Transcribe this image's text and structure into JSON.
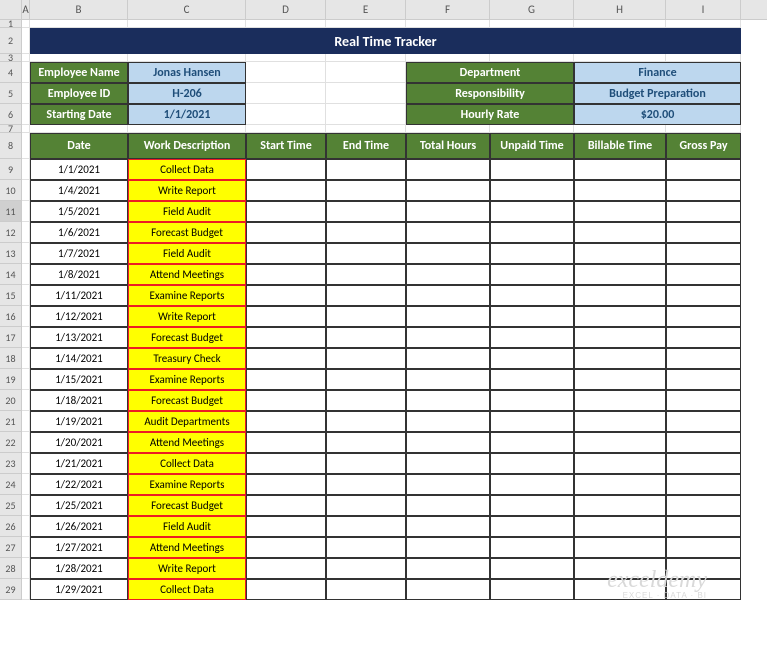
{
  "columns": [
    "A",
    "B",
    "C",
    "D",
    "E",
    "F",
    "G",
    "H",
    "I"
  ],
  "title": "Real Time Tracker",
  "info_left": [
    {
      "label": "Employee Name",
      "value": "Jonas Hansen"
    },
    {
      "label": "Employee ID",
      "value": "H-206"
    },
    {
      "label": "Starting Date",
      "value": "1/1/2021"
    }
  ],
  "info_right": [
    {
      "label": "Department",
      "value": "Finance"
    },
    {
      "label": "Responsibility",
      "value": "Budget Preparation"
    },
    {
      "label": "Hourly Rate",
      "value": "$20.00"
    }
  ],
  "headers": [
    "Date",
    "Work Description",
    "Start Time",
    "End Time",
    "Total Hours",
    "Unpaid Time",
    "Billable Time",
    "Gross Pay"
  ],
  "rows": [
    {
      "date": "1/1/2021",
      "desc": "Collect Data"
    },
    {
      "date": "1/4/2021",
      "desc": "Write Report"
    },
    {
      "date": "1/5/2021",
      "desc": "Field Audit"
    },
    {
      "date": "1/6/2021",
      "desc": "Forecast Budget"
    },
    {
      "date": "1/7/2021",
      "desc": "Field Audit"
    },
    {
      "date": "1/8/2021",
      "desc": "Attend Meetings"
    },
    {
      "date": "1/11/2021",
      "desc": "Examine Reports"
    },
    {
      "date": "1/12/2021",
      "desc": "Write Report"
    },
    {
      "date": "1/13/2021",
      "desc": "Forecast Budget"
    },
    {
      "date": "1/14/2021",
      "desc": "Treasury Check"
    },
    {
      "date": "1/15/2021",
      "desc": "Examine Reports"
    },
    {
      "date": "1/18/2021",
      "desc": "Forecast Budget"
    },
    {
      "date": "1/19/2021",
      "desc": "Audit Departments"
    },
    {
      "date": "1/20/2021",
      "desc": "Attend Meetings"
    },
    {
      "date": "1/21/2021",
      "desc": "Collect Data"
    },
    {
      "date": "1/22/2021",
      "desc": "Examine Reports"
    },
    {
      "date": "1/25/2021",
      "desc": "Forecast Budget"
    },
    {
      "date": "1/26/2021",
      "desc": "Field Audit"
    },
    {
      "date": "1/27/2021",
      "desc": "Attend Meetings"
    },
    {
      "date": "1/28/2021",
      "desc": "Write Report"
    },
    {
      "date": "1/29/2021",
      "desc": "Collect Data"
    }
  ],
  "watermark": {
    "main": "exceldemy",
    "sub": "EXCEL · DATA · BI"
  },
  "selected_row": 11
}
